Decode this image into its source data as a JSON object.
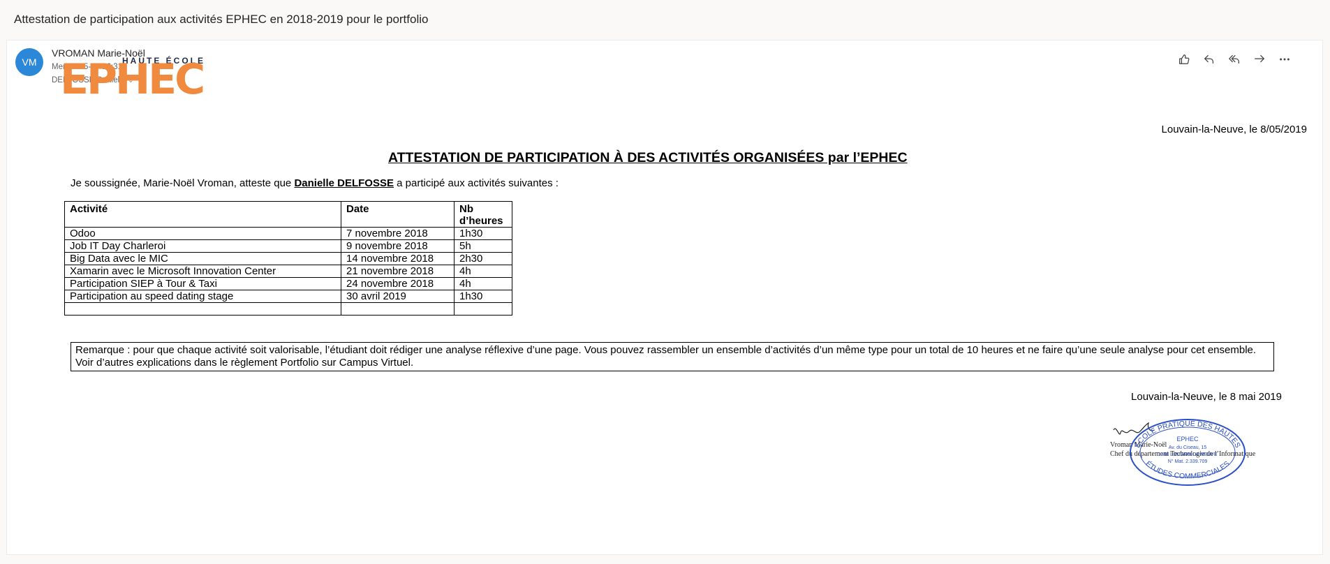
{
  "mail": {
    "subject": "Attestation de participation aux activités EPHEC en 2018-2019 pour le portfolio",
    "sender": {
      "initials": "VM",
      "name": "VROMAN Marie-Noël",
      "date": "Mer 08-05-19 16:31",
      "to": "DELFOSSE Danielle"
    },
    "actions": [
      "like-icon",
      "reply-icon",
      "reply-all-icon",
      "forward-icon",
      "more-icon"
    ]
  },
  "document": {
    "logo": {
      "top_text": "HAUTE ÉCOLE",
      "brand": "EPHEC"
    },
    "place_top": "Louvain-la-Neuve, le 8/05/2019",
    "title": "ATTESTATION DE PARTICIPATION À DES ACTIVITÉS ORGANISÉES par l’EPHEC",
    "intro": {
      "before": "Je soussignée, Marie-Noël Vroman, atteste que ",
      "name": "Danielle DELFOSSE",
      "after": " a participé aux activités suivantes :"
    },
    "table": {
      "headers": [
        "Activité",
        "Date",
        "Nb d’heures"
      ],
      "rows": [
        [
          "Odoo",
          "7 novembre 2018",
          "1h30"
        ],
        [
          "Job IT Day Charleroi",
          "9 novembre 2018",
          "5h"
        ],
        [
          "Big Data avec le MIC",
          "14 novembre 2018",
          "2h30"
        ],
        [
          "Xamarin avec le Microsoft Innovation Center",
          "21 novembre 2018",
          "4h"
        ],
        [
          "Participation SIEP à Tour & Taxi",
          "24 novembre 2018",
          "4h"
        ],
        [
          "Participation au speed dating stage",
          "30 avril 2019",
          "1h30"
        ],
        [
          "",
          "",
          ""
        ]
      ]
    },
    "remark": "Remarque : pour que chaque activité soit valorisable, l’étudiant doit rédiger une analyse réflexive d’une page. Vous pouvez rassembler un ensemble d’activités d’un même type pour un total de 10 heures et ne faire qu’une seule analyse pour cet ensemble. Voir d’autres explications dans le règlement Portfolio sur Campus Virtuel.",
    "place_bottom": "Louvain-la-Neuve, le 8 mai 2019",
    "signature": {
      "name": "Vroman Marie-Noël",
      "role": "Chef du département Technologie de l’Informatique",
      "stamp_lines": [
        "ÉCOLE PRATIQUE DES HAUTES",
        "EPHEC",
        "Av. du Ciseau, 15",
        "1348 LOUVAIN-LA-NEUVE",
        "N° Mat. 2.339.709",
        "ÉTUDES COMMERCIALES"
      ]
    }
  },
  "colors": {
    "avatar": "#2b88d8",
    "brand_orange": "#f08a3e",
    "stamp_blue": "#2b4fc6"
  }
}
